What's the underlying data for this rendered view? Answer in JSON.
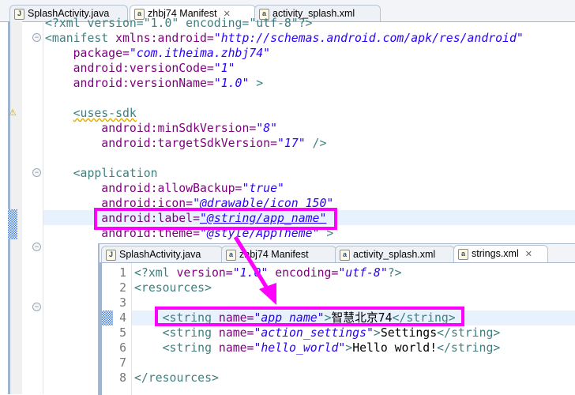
{
  "outer_tabs": [
    {
      "label": "SplashActivity.java",
      "icon": "java-file-icon"
    },
    {
      "label": "zhbj74 Manifest",
      "icon": "android-manifest-icon",
      "active": true
    },
    {
      "label": "activity_splash.xml",
      "icon": "xml-file-icon"
    }
  ],
  "manifest": {
    "l0": "<?xml version=\"1.0\" encoding=\"utf-8\"?>",
    "l1a": "<manifest ",
    "l1b": "xmlns:android=",
    "l1c": "\"http://schemas.android.com/apk/res/android\"",
    "l2a": "package=",
    "l2b": "\"com.itheima.zhbj74\"",
    "l3a": "android:versionCode=",
    "l3b": "\"1\"",
    "l4a": "android:versionName=",
    "l4b": "\"1.0\"",
    "l4c": " >",
    "l6": "<uses-sdk",
    "l7a": "android:minSdkVersion=",
    "l7b": "\"8\"",
    "l8a": "android:targetSdkVersion=",
    "l8b": "\"17\"",
    "l8c": " />",
    "l10": "<application",
    "l11a": "android:allowBackup=",
    "l11b": "\"true\"",
    "l12a": "android:icon=",
    "l12b": "\"@drawable/icon_150\"",
    "l13a": "android:label=",
    "l13b": "\"@string/app_name\"",
    "l14a": "android:theme=",
    "l14b": "\"@style/AppTheme\"",
    "l14c": " >"
  },
  "inner_tabs": [
    {
      "label": "SplashActivity.java"
    },
    {
      "label": "zhbj74 Manifest"
    },
    {
      "label": "activity_splash.xml"
    },
    {
      "label": "strings.xml",
      "active": true
    }
  ],
  "strings": {
    "line_numbers": [
      "1",
      "2",
      "3",
      "4",
      "5",
      "6",
      "7",
      "8"
    ],
    "l1a": "<?xml ",
    "l1b": "version=",
    "l1c": "\"1.0\"",
    "l1d": " encoding=",
    "l1e": "\"utf-8\"",
    "l1f": "?>",
    "l2": "<resources>",
    "l4a": "<string ",
    "l4b": "name=",
    "l4c": "\"app_name\"",
    "l4d": ">",
    "l4e": "智慧北京74",
    "l4f": "</string>",
    "l5a": "<string ",
    "l5b": "name=",
    "l5c": "\"action_settings\"",
    "l5d": ">",
    "l5e": "Settings",
    "l5f": "</string>",
    "l6a": "<string ",
    "l6b": "name=",
    "l6c": "\"hello_world\"",
    "l6d": ">",
    "l6e": "Hello world!",
    "l6f": "</string>",
    "l8": "</resources>"
  },
  "colors": {
    "highlight": "#ff00ff",
    "tag": "#3f7f7f",
    "attr": "#7f007f",
    "string": "#2a00ff"
  }
}
